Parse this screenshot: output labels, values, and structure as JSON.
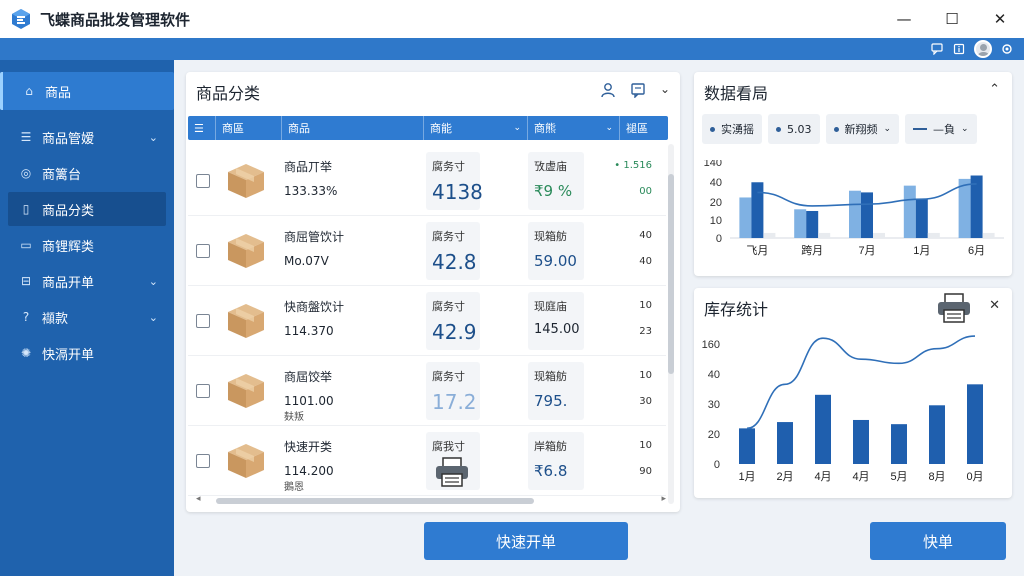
{
  "window": {
    "title": "飞蝶商品批发管理软件",
    "controls": [
      "—",
      "☐",
      "✕"
    ]
  },
  "sidebar": {
    "items": [
      {
        "label": "商品",
        "icon": "home-icon",
        "chevron": false
      },
      {
        "label": "商品管嫒",
        "icon": "list-icon",
        "chevron": true
      },
      {
        "label": "商篱台",
        "icon": "target-icon",
        "chevron": false
      },
      {
        "label": "商品分类",
        "icon": "phone-icon",
        "chevron": false
      },
      {
        "label": "商锂辉类",
        "icon": "card-icon",
        "chevron": false
      },
      {
        "label": "商品开单",
        "icon": "grid-icon",
        "chevron": true
      },
      {
        "label": "襭款",
        "icon": "question-icon",
        "chevron": true
      },
      {
        "label": "快滆开单",
        "icon": "gear-icon",
        "chevron": false
      }
    ]
  },
  "category_panel": {
    "title": "商品分类",
    "columns": [
      {
        "label": "商區",
        "chevron": false
      },
      {
        "label": "商品",
        "chevron": false
      },
      {
        "label": "商能",
        "chevron": true
      },
      {
        "label": "商熊",
        "chevron": true
      },
      {
        "label": "褪區",
        "chevron": false
      }
    ],
    "rows": [
      {
        "name": "商品丌举",
        "value": "133.33%",
        "sub": "",
        "card1_label": "腐务寸",
        "card1_value": "4138",
        "card2_label": "攷虚庙",
        "card2_value": "₹9 %",
        "r1": "• 1.516",
        "r2": "00"
      },
      {
        "name": "商屈管饮计",
        "value": "Mo.07V",
        "sub": "",
        "card1_label": "腐务寸",
        "card1_value": "42.8",
        "card2_label": "现箱舫",
        "card2_value": "59.00",
        "r1": "40",
        "r2": "40"
      },
      {
        "name": "快商盤饮计",
        "value": "114.370",
        "sub": "",
        "card1_label": "腐务寸",
        "card1_value": "42.9",
        "card2_label": "现庭庙",
        "card2_value": "145.00",
        "r1": "10",
        "r2": "23"
      },
      {
        "name": "商屆饺举",
        "value": "1101.00",
        "sub": "麸叛",
        "card1_label": "腐务寸",
        "card1_value": "17.2",
        "card2_label": "现箱舫",
        "card2_value": "795.",
        "r1": "10",
        "r2": "30"
      },
      {
        "name": "快速开类",
        "value": "114.200",
        "sub": "鵝恩",
        "card1_label": "腐我寸",
        "card1_value": "",
        "card2_label": "岸箱舫",
        "card2_value": "₹6.8",
        "r1": "10",
        "r2": "90"
      }
    ]
  },
  "dashboard": {
    "title": "数据看局",
    "chips": [
      {
        "label": "实湧摇",
        "marker": "dot",
        "chevron": false
      },
      {
        "label": "5.03",
        "marker": "dot",
        "chevron": false
      },
      {
        "label": "新翔频",
        "marker": "dot",
        "chevron": true
      },
      {
        "label": "—負",
        "marker": "none",
        "chevron": true
      }
    ]
  },
  "inventory": {
    "title": "库存统计"
  },
  "buttons": {
    "quick_order": "快速开单",
    "order": "快单"
  },
  "colors": {
    "primary": "#2f7bd1",
    "sidebar": "#1f62ad",
    "bar_dark": "#1f5fae",
    "bar_light": "#7fb1e3"
  },
  "chart_data": [
    {
      "type": "bar",
      "categories": [
        "飞月",
        "跨月",
        "7月",
        "1月",
        "6月"
      ],
      "series": [
        {
          "values": [
            24,
            17,
            28,
            31,
            35
          ]
        },
        {
          "values": [
            33,
            16,
            27,
            23,
            37
          ]
        },
        {
          "values": [
            3,
            3,
            3,
            3,
            3
          ]
        }
      ],
      "line": [
        27,
        19,
        20,
        23,
        32
      ],
      "yticks": [
        0,
        10,
        20,
        40,
        140
      ],
      "ylim": [
        0,
        45
      ]
    },
    {
      "type": "bar",
      "categories": [
        "1月",
        "2月",
        "4月",
        "4月",
        "5月",
        "8月",
        "0月"
      ],
      "values": [
        17,
        20,
        33,
        21,
        19,
        28,
        38
      ],
      "line": [
        17,
        38,
        60,
        50,
        48,
        55,
        61
      ],
      "yticks": [
        0,
        20,
        30,
        40,
        160
      ],
      "ylim": [
        0,
        62
      ]
    }
  ]
}
